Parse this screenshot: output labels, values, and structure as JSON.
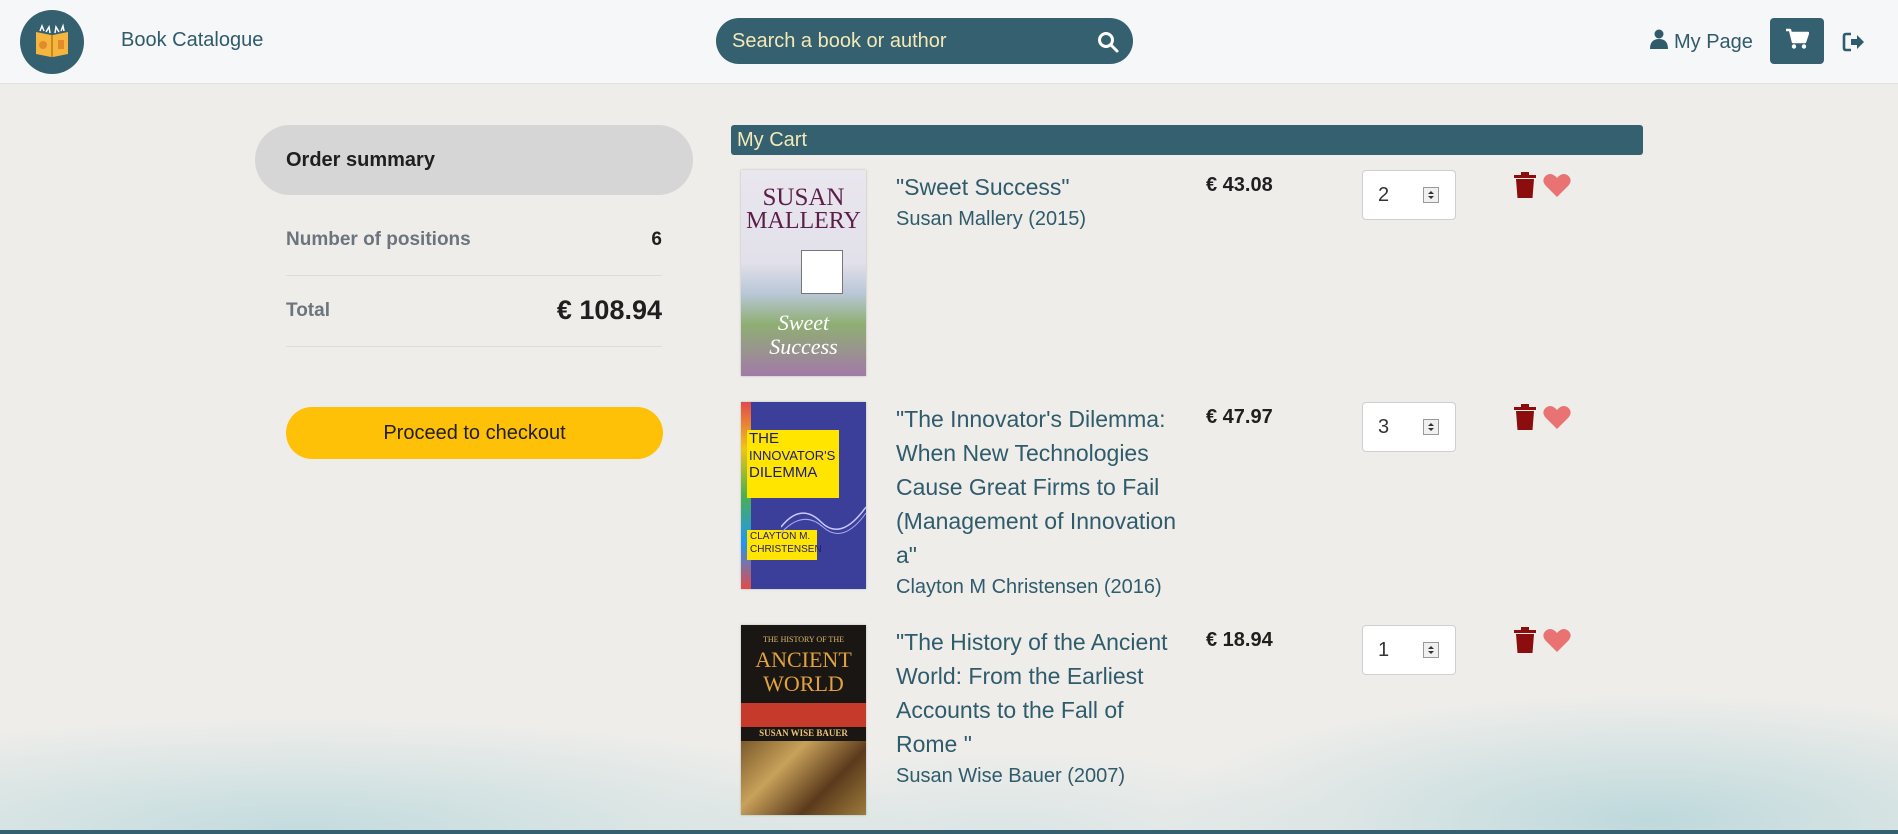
{
  "header": {
    "brand": "Book Catalogue",
    "search_placeholder": "Search a book or author",
    "my_page": "My Page"
  },
  "summary": {
    "title": "Order summary",
    "positions_label": "Number of positions",
    "positions_value": "6",
    "total_label": "Total",
    "total_value": "€ 108.94",
    "checkout_label": "Proceed to checkout"
  },
  "cart": {
    "title": "My Cart",
    "items": [
      {
        "title": "\"Sweet Success\"",
        "author": "Susan Mallery (2015)",
        "price": "€ 43.08",
        "qty": "2",
        "cover_lines": [
          "SUSAN",
          "MALLERY",
          "Sweet",
          "Success"
        ]
      },
      {
        "title": "\"The Innovator's Dilemma: When New Technologies Cause Great Firms to Fail (Management of Innovation a\"",
        "author": "Clayton M Christensen (2016)",
        "price": "€ 47.97",
        "qty": "3",
        "cover_lines": [
          "THE",
          "INNOVATOR'S",
          "DILEMMA",
          "CLAYTON M.",
          "CHRISTENSEN"
        ]
      },
      {
        "title": "\"The History of the Ancient World: From the Earliest Accounts to the Fall of Rome \"",
        "author": "Susan Wise Bauer (2007)",
        "price": "€ 18.94",
        "qty": "1",
        "cover_lines": [
          "THE HISTORY OF THE",
          "ANCIENT",
          "WORLD",
          "SUSAN WISE BAUER"
        ]
      }
    ]
  },
  "colors": {
    "primary": "#34606f",
    "accent": "#fec107",
    "trash": "#8b0d0d",
    "heart": "#e97272"
  },
  "icons": [
    "book-logo-icon",
    "search-icon",
    "user-icon",
    "cart-icon",
    "logout-icon",
    "trash-icon",
    "heart-icon"
  ]
}
